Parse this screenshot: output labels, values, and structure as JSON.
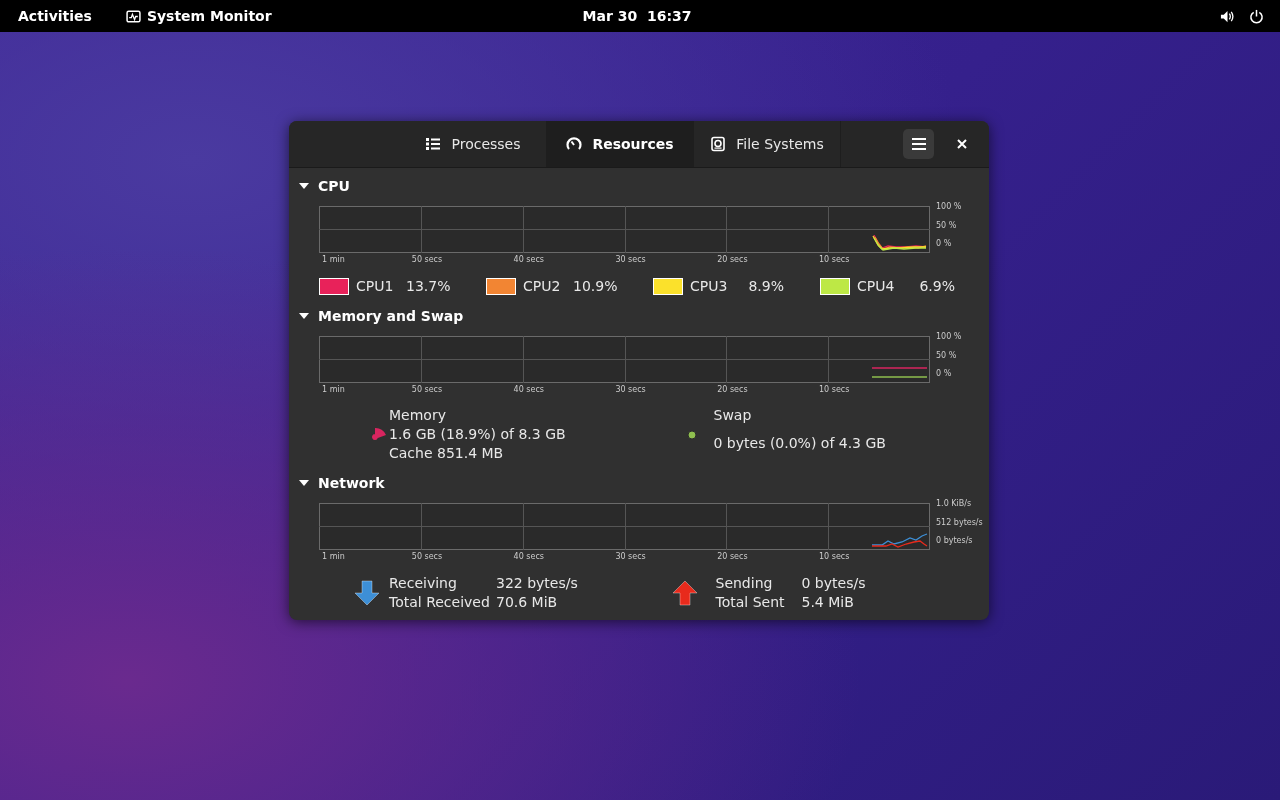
{
  "top_bar": {
    "activities": "Activities",
    "app_name": "System Monitor",
    "clock": "Mar 30  16:37"
  },
  "window": {
    "tabs": [
      {
        "label": "Processes",
        "selected": false,
        "kind": "list"
      },
      {
        "label": "Resources",
        "selected": true,
        "kind": "gauge"
      },
      {
        "label": "File Systems",
        "selected": false,
        "kind": "disk"
      }
    ],
    "sections": [
      {
        "title": "CPU",
        "expanded": true,
        "kind": "cpu",
        "x_labels": [
          "1 min",
          "50 secs",
          "40 secs",
          "30 secs",
          "20 secs",
          "10 secs"
        ],
        "y_labels": [
          "100 %",
          "50 %",
          "0 %"
        ],
        "legend": [
          {
            "name": "CPU1",
            "value": "13.7%",
            "color": "#e8225a"
          },
          {
            "name": "CPU2",
            "value": "10.9%",
            "color": "#f28533"
          },
          {
            "name": "CPU3",
            "value": "8.9%",
            "color": "#fbe12b"
          },
          {
            "name": "CPU4",
            "value": "6.9%",
            "color": "#bde845"
          }
        ]
      },
      {
        "title": "Memory and Swap",
        "expanded": true,
        "kind": "memory",
        "x_labels": [
          "1 min",
          "50 secs",
          "40 secs",
          "30 secs",
          "20 secs",
          "10 secs"
        ],
        "y_labels": [
          "100 %",
          "50 %",
          "0 %"
        ],
        "items": [
          {
            "name": "Memory",
            "lines": [
              "1.6 GB (18.9%) of 8.3 GB",
              "Cache 851.4 MB"
            ],
            "color": "#d8255f"
          },
          {
            "name": "Swap",
            "lines": [
              "0 bytes (0.0%) of 4.3 GB"
            ],
            "color": "#8fbf4f"
          }
        ]
      },
      {
        "title": "Network",
        "expanded": true,
        "kind": "network",
        "x_labels": [
          "1 min",
          "50 secs",
          "40 secs",
          "30 secs",
          "20 secs",
          "10 secs"
        ],
        "y_labels": [
          "1.0 KiB/s",
          "512 bytes/s",
          "0 bytes/s"
        ],
        "items": [
          {
            "kind": "receive",
            "color": "#3d8fd6",
            "rows": [
              {
                "label": "Receiving",
                "value": "322 bytes/s"
              },
              {
                "label": "Total Received",
                "value": "70.6 MiB"
              }
            ]
          },
          {
            "kind": "send",
            "color": "#e82a1c",
            "rows": [
              {
                "label": "Sending",
                "value": "0 bytes/s"
              },
              {
                "label": "Total Sent",
                "value": "5.4 MiB"
              }
            ]
          }
        ]
      }
    ]
  }
}
